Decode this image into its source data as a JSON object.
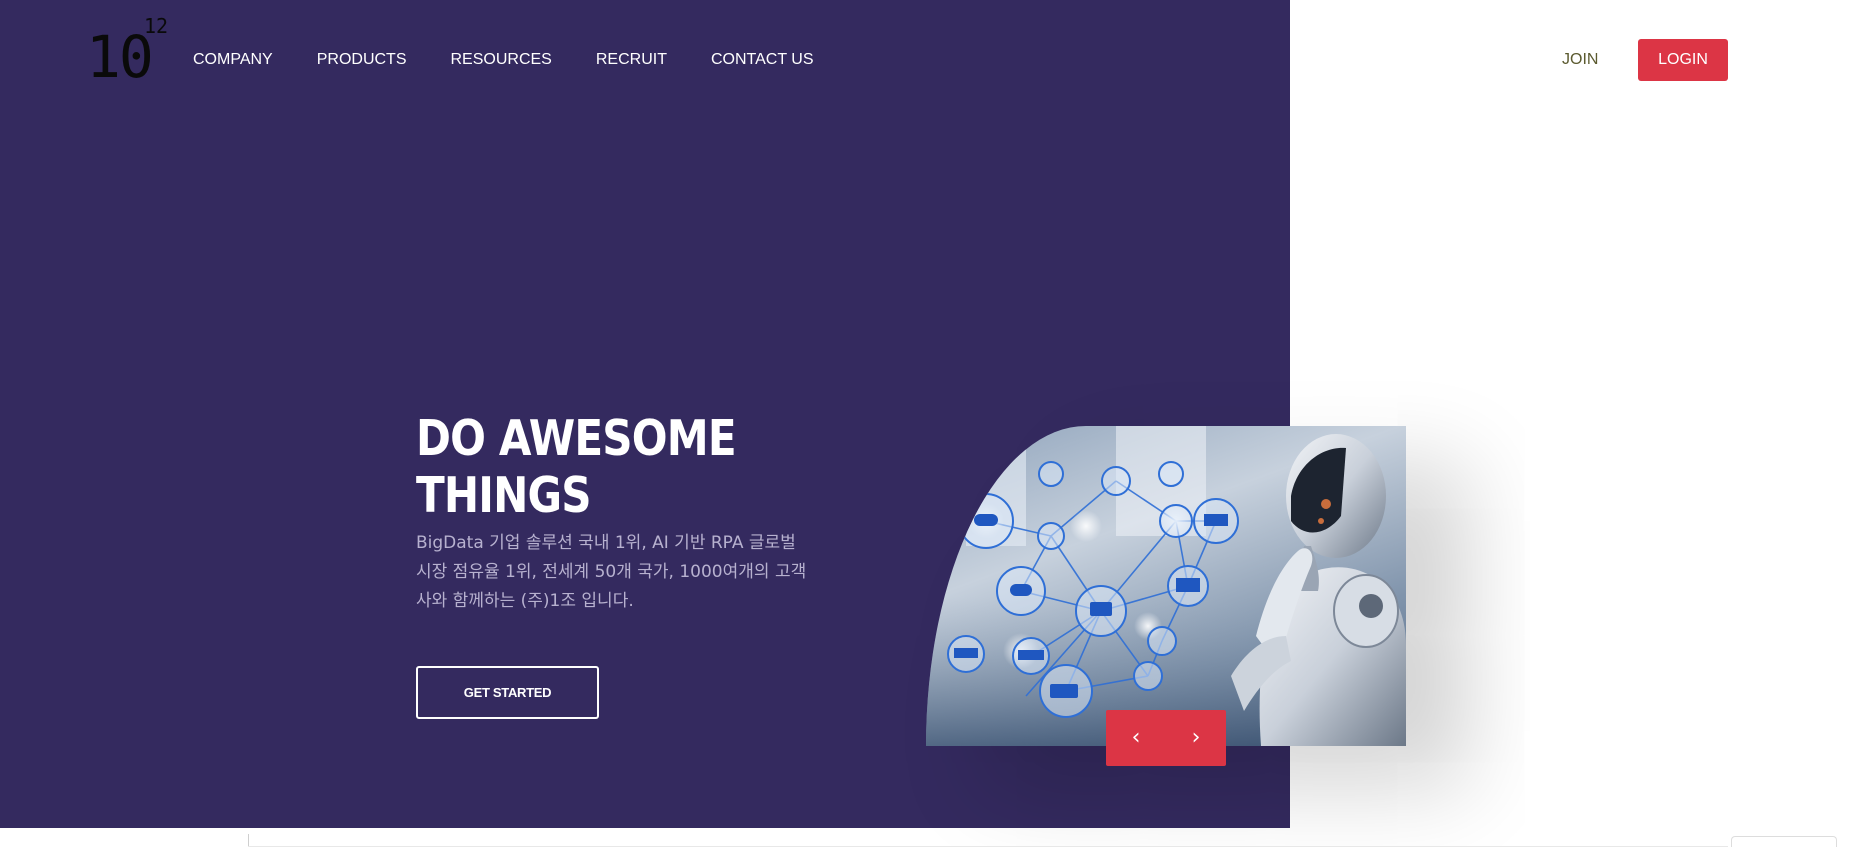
{
  "colors": {
    "hero_bg": "#342a5f",
    "accent": "#dc3545",
    "text_light": "#ffffff",
    "desc_text": "#b7b1cf"
  },
  "header": {
    "logo": {
      "main": "10",
      "exponent": "12"
    },
    "nav": [
      {
        "label": "COMPANY"
      },
      {
        "label": "PRODUCTS"
      },
      {
        "label": "RESOURCES"
      },
      {
        "label": "RECRUIT"
      },
      {
        "label": "CONTACT US"
      }
    ],
    "join_label": "JOIN",
    "login_label": "LOGIN"
  },
  "hero": {
    "title_line1": "DO AWESOME",
    "title_line2": "THINGS",
    "description": "BigData 기업 솔루션 국내 1위, AI 기반 RPA 글로벌 시장 점유율 1위, 전세계 50개 국가, 1000여개의 고객사와 함께하는 (주)1조 입니다.",
    "cta_label": "GET STARTED",
    "image_icon": "robot-network-image",
    "slider": {
      "prev_icon": "chevron-left-icon",
      "next_icon": "chevron-right-icon",
      "prev_glyph": "‹",
      "next_glyph": "›"
    }
  }
}
